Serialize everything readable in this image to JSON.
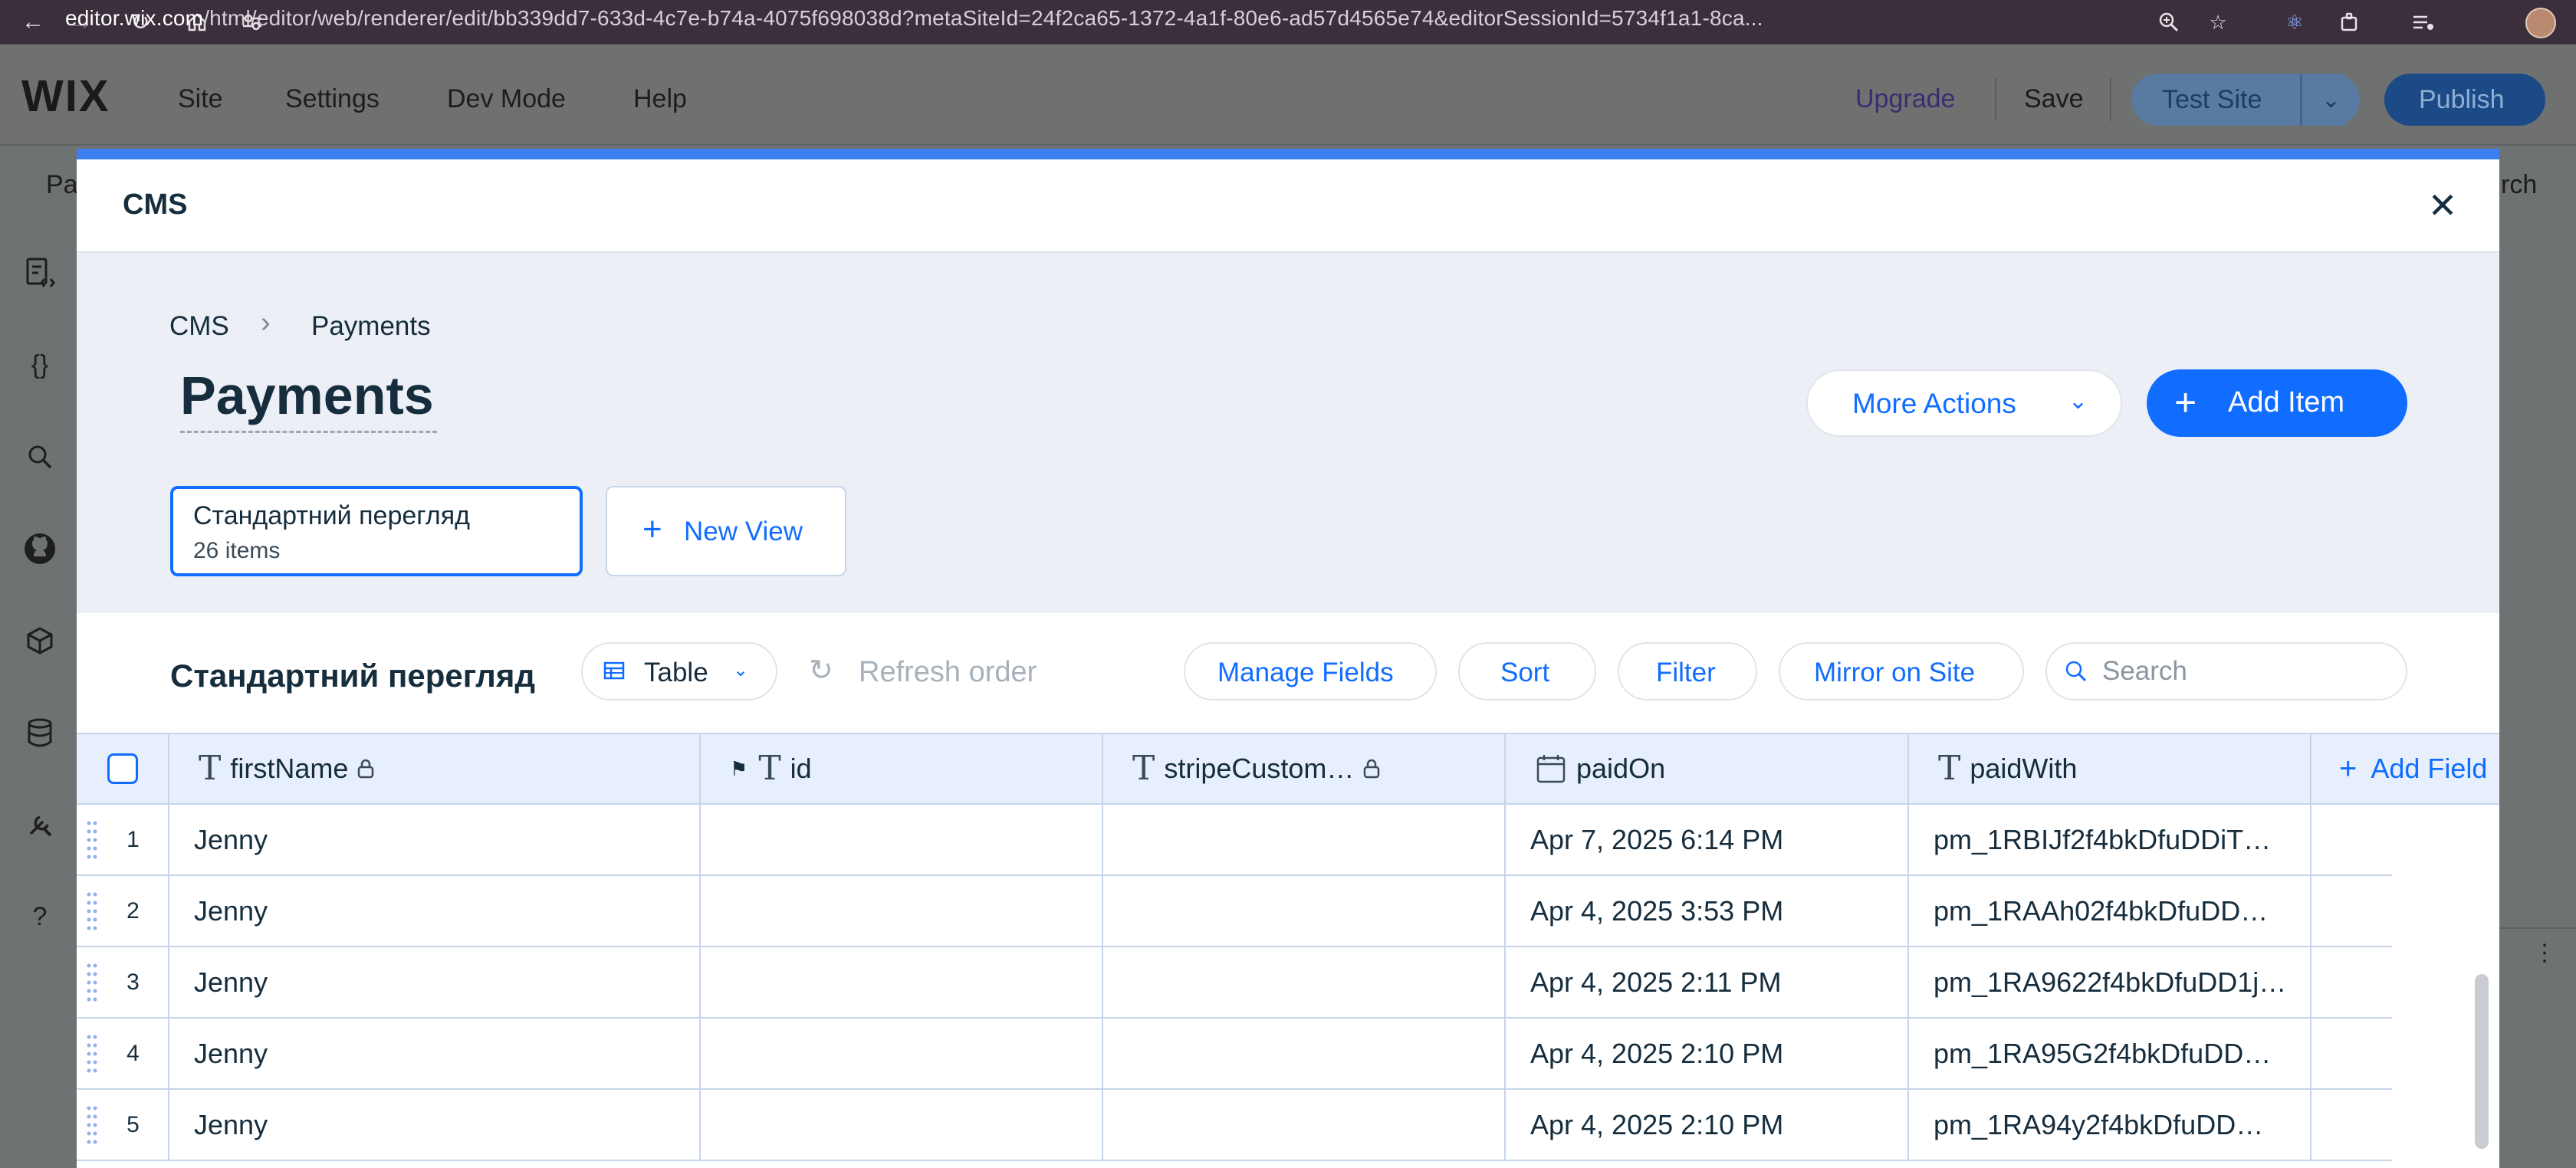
{
  "browser": {
    "url_host": "editor.wix.com",
    "url_path": "/html/editor/web/renderer/edit/bb339dd7-633d-4c7e-b74a-4075f698038d?metaSiteId=24f2ca65-1372-4a1f-80e6-ad57d4565e74&editorSessionId=5734f1a1-8ca..."
  },
  "wix": {
    "logo": "WIX",
    "menu": [
      "Site",
      "Settings",
      "Dev Mode",
      "Help"
    ],
    "upgrade": "Upgrade",
    "save": "Save",
    "test_site": "Test Site",
    "publish": "Publish",
    "sub_left": "Pa",
    "sub_right": "rch"
  },
  "modal": {
    "title": "CMS",
    "breadcrumb": [
      "CMS",
      "Payments"
    ],
    "page_title": "Payments",
    "more_actions": "More Actions",
    "add_item": "Add Item",
    "view": {
      "name": "Стандартний перегляд",
      "count": "26 items"
    },
    "new_view": "New View"
  },
  "panel": {
    "title": "Стандартний перегляд",
    "layout": "Table",
    "refresh": "Refresh order",
    "manage_fields": "Manage Fields",
    "sort": "Sort",
    "filter": "Filter",
    "mirror": "Mirror on Site",
    "search_placeholder": "Search"
  },
  "table": {
    "columns": [
      "firstName",
      "id",
      "stripeCustom…",
      "paidOn",
      "paidWith"
    ],
    "add_field": "Add Field",
    "rows": [
      {
        "n": "1",
        "firstName": "Jenny",
        "id": "",
        "stripe": "",
        "paidOn": "Apr 7, 2025 6:14 PM",
        "paidWith": "pm_1RBIJf2f4bkDfuDDiT…"
      },
      {
        "n": "2",
        "firstName": "Jenny",
        "id": "",
        "stripe": "",
        "paidOn": "Apr 4, 2025 3:53 PM",
        "paidWith": "pm_1RAAh02f4bkDfuDD…"
      },
      {
        "n": "3",
        "firstName": "Jenny",
        "id": "",
        "stripe": "",
        "paidOn": "Apr 4, 2025 2:11 PM",
        "paidWith": "pm_1RA9622f4bkDfuDD1j…"
      },
      {
        "n": "4",
        "firstName": "Jenny",
        "id": "",
        "stripe": "",
        "paidOn": "Apr 4, 2025 2:10 PM",
        "paidWith": "pm_1RA95G2f4bkDfuDD…"
      },
      {
        "n": "5",
        "firstName": "Jenny",
        "id": "",
        "stripe": "",
        "paidOn": "Apr 4, 2025 2:10 PM",
        "paidWith": "pm_1RA94y2f4bkDfuDD…"
      }
    ]
  },
  "colors": {
    "accent": "#116dff",
    "modal_bar": "#3b7ef1",
    "browser": "#3c2f3c"
  }
}
